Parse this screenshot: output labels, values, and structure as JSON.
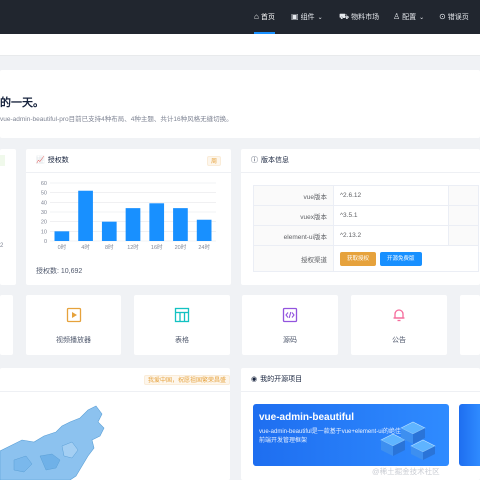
{
  "nav": {
    "items": [
      {
        "label": "首页",
        "icon": "home-icon",
        "active": true
      },
      {
        "label": "组件",
        "icon": "component-icon"
      },
      {
        "label": "物料市场",
        "icon": "cart-icon"
      },
      {
        "label": "配置",
        "icon": "user-config-icon"
      },
      {
        "label": "错误页",
        "icon": "error-icon"
      }
    ]
  },
  "welcome": {
    "greeting": "的一天。",
    "description": "vue-admin-beautiful-pro目前已支持4种布局、4种主题、共计16种风格无缝切换。"
  },
  "auth_card": {
    "title": "授权数",
    "tag": "周",
    "count_label": "授权数: 10,692"
  },
  "chart_data": {
    "type": "bar",
    "categories": [
      "0时",
      "4时",
      "8时",
      "12时",
      "16时",
      "20时",
      "24时"
    ],
    "values": [
      10,
      52,
      20,
      34,
      39,
      34,
      22
    ],
    "ylim": [
      0,
      60
    ],
    "yticks": [
      "0",
      "10",
      "20",
      "30",
      "40",
      "50",
      "60"
    ],
    "bar_color": "#1890ff",
    "grid": true
  },
  "version_card": {
    "title": "版本信息",
    "rows": [
      {
        "key": "vue版本",
        "value": "^2.6.12"
      },
      {
        "key": "vuex版本",
        "value": "^3.5.1"
      },
      {
        "key": "element-ui版本",
        "value": "^2.13.2"
      }
    ],
    "channel_key": "授权渠道",
    "btn_get": "获取授权",
    "btn_free": "开源免费版"
  },
  "shortcuts": [
    {
      "label": "视频播放器",
      "icon": "video-icon",
      "color": "#e6a23c"
    },
    {
      "label": "表格",
      "icon": "table-icon",
      "color": "#13c2c2"
    },
    {
      "label": "源码",
      "icon": "code-icon",
      "color": "#9254de"
    },
    {
      "label": "公告",
      "icon": "bell-icon",
      "color": "#f56c9c"
    }
  ],
  "map_card": {
    "tag": "我爱中国，祝愿祖国繁荣昌盛"
  },
  "proj_card": {
    "title": "我的开源项目",
    "banner_title": "vue-admin-beautiful",
    "banner_desc": "vue-admin-beautiful是一款基于vue+element-ui的绝佳的中后台前端开发管理框架"
  },
  "watermark": "@稀土掘金技术社区",
  "colors": {
    "primary": "#1890ff",
    "topbar": "#21262f",
    "page_bg": "#f0f2f5"
  }
}
